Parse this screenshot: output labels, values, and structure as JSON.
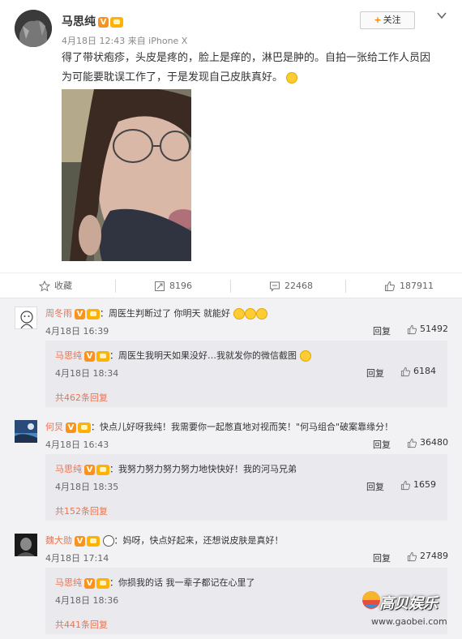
{
  "post": {
    "author": "马思纯",
    "meta": "4月18日 12:43 来自 iPhone X",
    "follow_label": "关注",
    "text": "得了带状疱疹，头皮是疼的，脸上是痒的，淋巴是肿的。自拍一张给工作人员因为可能要耽误工作了，于是发现自己皮肤真好。"
  },
  "actions": {
    "favorite_label": "收藏",
    "repost_count": "8196",
    "comment_count": "22468",
    "like_count": "187911"
  },
  "comments": [
    {
      "name": "周冬雨",
      "text": "：周医生判断过了 你明天 就能好",
      "time": "4月18日 16:39",
      "reply_label": "回复",
      "likes": "51492",
      "reply": {
        "name": "马思纯",
        "text": "：周医生我明天如果没好…我就发你的微信截图",
        "time": "4月18日 18:34",
        "reply_label": "回复",
        "likes": "6184"
      },
      "more": "共462条回复"
    },
    {
      "name": "何炅",
      "text": "：快点儿好呀我纯！我需要你一起憋直地对视而笑！\"何马组合\"破案靠缘分！",
      "time": "4月18日 16:43",
      "reply_label": "回复",
      "likes": "36480",
      "reply": {
        "name": "马思纯",
        "text": "：我努力努力努力努力地快快好！我的河马兄弟",
        "time": "4月18日 18:35",
        "reply_label": "回复",
        "likes": "1659"
      },
      "more": "共152条回复"
    },
    {
      "name": "魏大勋",
      "text": "：妈呀，快点好起来，还想说皮肤是真好！",
      "time": "4月18日 17:14",
      "reply_label": "回复",
      "likes": "27489",
      "reply": {
        "name": "马思纯",
        "text": "：你损我的话 我一辈子都记在心里了",
        "time": "4月18日 18:36"
      },
      "more": "共441条回复"
    }
  ],
  "watermark": {
    "text": "高贝娱乐",
    "url": "www.gaobei.com"
  }
}
